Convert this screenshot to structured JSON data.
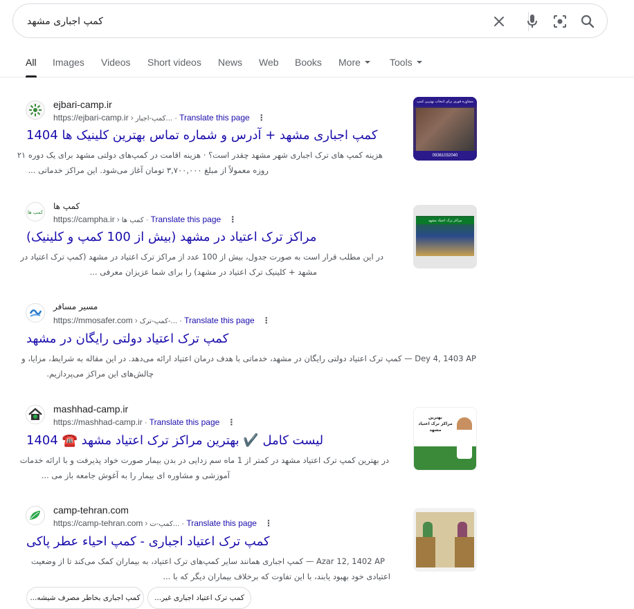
{
  "search": {
    "query": "کمپ اجباری مشهد",
    "placeholder": ""
  },
  "tabs": [
    {
      "label": "All",
      "active": true
    },
    {
      "label": "Images"
    },
    {
      "label": "Videos"
    },
    {
      "label": "Short videos"
    },
    {
      "label": "News"
    },
    {
      "label": "Web"
    },
    {
      "label": "Books"
    },
    {
      "label": "More"
    },
    {
      "label": "Tools"
    }
  ],
  "results": [
    {
      "site_name": "ejbari-camp.ir",
      "url": "https://ejbari-camp.ir",
      "crumb": "کمپ-اجبار...",
      "translate": "Translate this page",
      "title": "کمپ اجباری مشهد + آدرس و شماره تماس بهترین کلینیک ها 1404",
      "snippet_1": "هزینه کمپ های ترک اجباری شهر مشهد چقدر است؟ · هزینه اقامت در کمپ‌های دولتی مشهد برای یک دوره ۲۱",
      "snippet_2": "روزه معمولاً از مبلغ ۳,۷۰۰,۰۰۰ تومان آغاز می‌شود. این مراکز خدماتی ...",
      "thumb_text_1": "مشاوره فوری برای انتخاب بهترین کمپ",
      "thumb_text_2": "09361032040"
    },
    {
      "site_name": "کمپ ها",
      "url": "https://campha.ir",
      "crumb": "کمپ ها",
      "translate": "Translate this page",
      "title": "مراکز ترک اعتیاد در مشهد (بیش از 100 کمپ و کلینیک)",
      "snippet_1": "در این مطلب قرار است به صورت جدول، بیش از 100 عدد از مراکز ترک اعتیاد در مشهد (کمپ ترک اعتیاد در",
      "snippet_2": "مشهد + کلینیک ترک اعتیاد در مشهد) را برای شما عزیزان معرفی ...",
      "thumb_text_1": "مراکز ترک اعتیاد مشهد"
    },
    {
      "site_name": "مسیر مسافر",
      "url": "https://mmosafer.com",
      "crumb": "کمپ-ترک-...",
      "translate": "Translate this page",
      "title": "کمپ ترک اعتیاد دولتی رایگان در مشهد",
      "snippet_1": "Dey 4, 1403 AP — کمپ ترک اعتیاد دولتی رایگان در مشهد، خدماتی با هدف درمان اعتیاد ارائه می‌دهد. در این مقاله به شرایط، مزایا، و",
      "snippet_2": "چالش‌های این مراکز می‌پردازیم."
    },
    {
      "site_name": "mashhad-camp.ir",
      "url": "https://mashhad-camp.ir",
      "crumb": "",
      "translate": "Translate this page",
      "title": "لیست کامل ✔️ بهترین مراکز ترک اعتیاد مشهد ☎️ 1404",
      "snippet_1": "در بهترین کمپ ترک اعتیاد مشهد در کمتر از 1 ماه سم زدایی در بدن بیمار صورت خواد پذیرفت و با ارائه خدمات",
      "snippet_2": "آموزشی و مشاوره ای بیمار را به آغوش جامعه باز می ...",
      "thumb_text_1": "بهترین",
      "thumb_text_2": "مراکز ترک اعتیاد",
      "thumb_text_3": "مشهد"
    },
    {
      "site_name": "camp-tehran.com",
      "url": "https://camp-tehran.com",
      "crumb": "کمپ-ت...",
      "translate": "Translate this page",
      "title": "کمپ ترک اعتیاد اجباری - کمپ احیاء عطر پاکی",
      "snippet_1": "Azar 12, 1402 AP — کمپ اجباری همانند سایر کمپ‌های ترک اعتیاد، به بیماران کمک می‌کند تا از وضعیت",
      "snippet_2": "اعتیادی خود بهبود یابند، با این تفاوت که برخلاف بیماران دیگر که با ..."
    }
  ],
  "chips": [
    "کمپ ترک اعتیاد اجباری غیر...",
    "کمپ اجباری بخاطر مصرف شیشه..."
  ],
  "colors": {
    "link": "#1a0dab",
    "text": "#202124",
    "muted": "#4d5156",
    "border": "#dadce0"
  }
}
